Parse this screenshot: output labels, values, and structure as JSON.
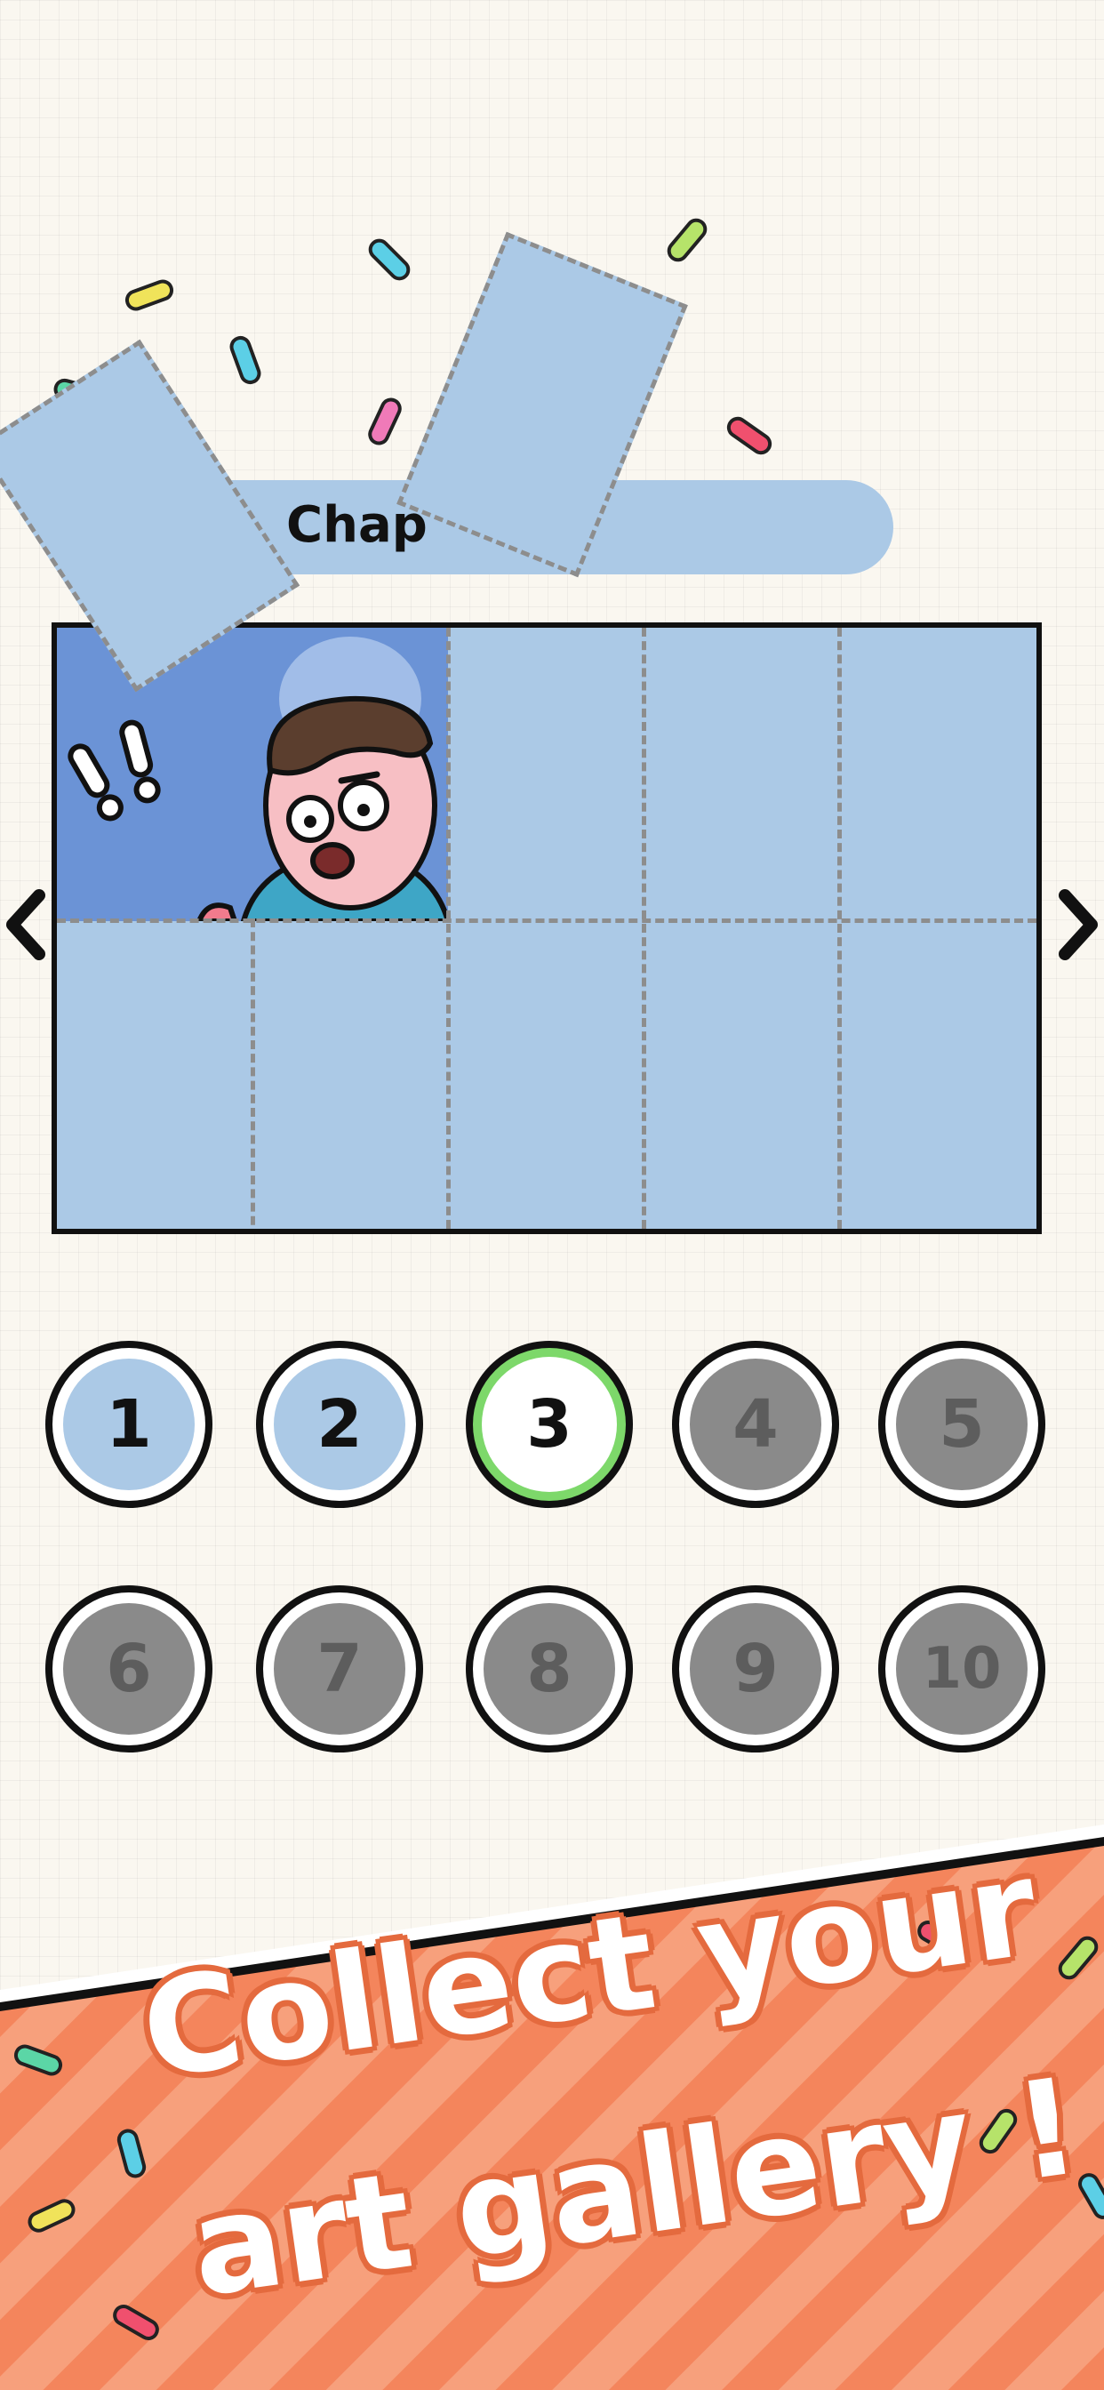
{
  "chapter": {
    "label": "Chap"
  },
  "board": {
    "columns": 5,
    "rows": 2,
    "revealed_pieces": 1
  },
  "navigation": {
    "prev_label": "‹",
    "next_label": "›"
  },
  "levels": [
    {
      "number": "1",
      "state": "unlocked"
    },
    {
      "number": "2",
      "state": "unlocked"
    },
    {
      "number": "3",
      "state": "current"
    },
    {
      "number": "4",
      "state": "locked"
    },
    {
      "number": "5",
      "state": "locked"
    },
    {
      "number": "6",
      "state": "locked"
    },
    {
      "number": "7",
      "state": "locked"
    },
    {
      "number": "8",
      "state": "locked"
    },
    {
      "number": "9",
      "state": "locked"
    },
    {
      "number": "10",
      "state": "locked"
    }
  ],
  "banner": {
    "line1": "Collect your",
    "line2": "art gallery !"
  },
  "colors": {
    "background": "#faf7f0",
    "piece_blue": "#abc9e6",
    "banner_orange": "#f4855c",
    "banner_stripe": "#f7a07c",
    "current_ring": "#7dd86a",
    "locked_gray": "#8a8a8a"
  }
}
